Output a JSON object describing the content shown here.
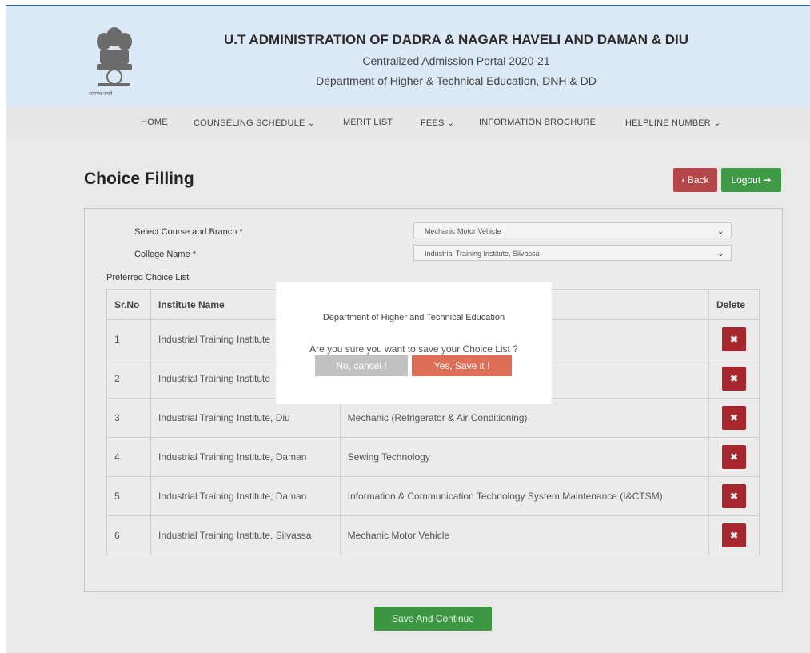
{
  "header": {
    "title": "U.T ADMINISTRATION OF DADRA & NAGAR HAVELI AND DAMAN & DIU",
    "subtitle1": "Centralized Admission Portal 2020-21",
    "subtitle2": "Department of Higher & Technical Education, DNH & DD",
    "emblem_caption": "सत्यमेव जयते"
  },
  "nav": {
    "home": "HOME",
    "counseling": "COUNSELING SCHEDULE ⌄",
    "merit": "MERIT LIST",
    "fees": "FEES ⌄",
    "brochure": "INFORMATION BROCHURE",
    "helpline": "HELPLINE NUMBER ⌄"
  },
  "page": {
    "title": "Choice Filling",
    "back_label": "‹ Back",
    "logout_label": "Logout ➔"
  },
  "form": {
    "course_label": "Select Course and Branch *",
    "course_value": "Mechanic Motor Vehicle",
    "college_label": "College Name *",
    "college_value": "Industrial Training Institute, Silvassa",
    "pref_label": "Preferred Choice List"
  },
  "table": {
    "headers": {
      "sr": "Sr.No",
      "institute": "Institute Name",
      "course": "",
      "delete": "Delete"
    },
    "rows": [
      {
        "sr": "1",
        "institute": "Industrial Training Institute",
        "course": ""
      },
      {
        "sr": "2",
        "institute": "Industrial Training Institute",
        "course": ""
      },
      {
        "sr": "3",
        "institute": "Industrial Training Institute, Diu",
        "course": "Mechanic (Refrigerator & Air Conditioning)"
      },
      {
        "sr": "4",
        "institute": "Industrial Training Institute, Daman",
        "course": "Sewing Technology"
      },
      {
        "sr": "5",
        "institute": "Industrial Training Institute, Daman",
        "course": "Information & Communication Technology System Maintenance (I&CTSM)"
      },
      {
        "sr": "6",
        "institute": "Industrial Training Institute, Silvassa",
        "course": "Mechanic Motor Vehicle"
      }
    ],
    "delete_glyph": "✖"
  },
  "save_continue_label": "Save And Continue",
  "modal": {
    "title": "Department of Higher and Technical Education",
    "message": "Are you sure you want to save your Choice List ?",
    "cancel_label": "No, cancel !",
    "confirm_label": "Yes, Save it !"
  },
  "colors": {
    "header_bg": "#dbe8f6",
    "back_button": "#b5474a",
    "logout_button": "#3f9a45",
    "delete_button": "#a8262e",
    "confirm_button": "#de6e55",
    "cancel_button": "#c1c1c1"
  }
}
